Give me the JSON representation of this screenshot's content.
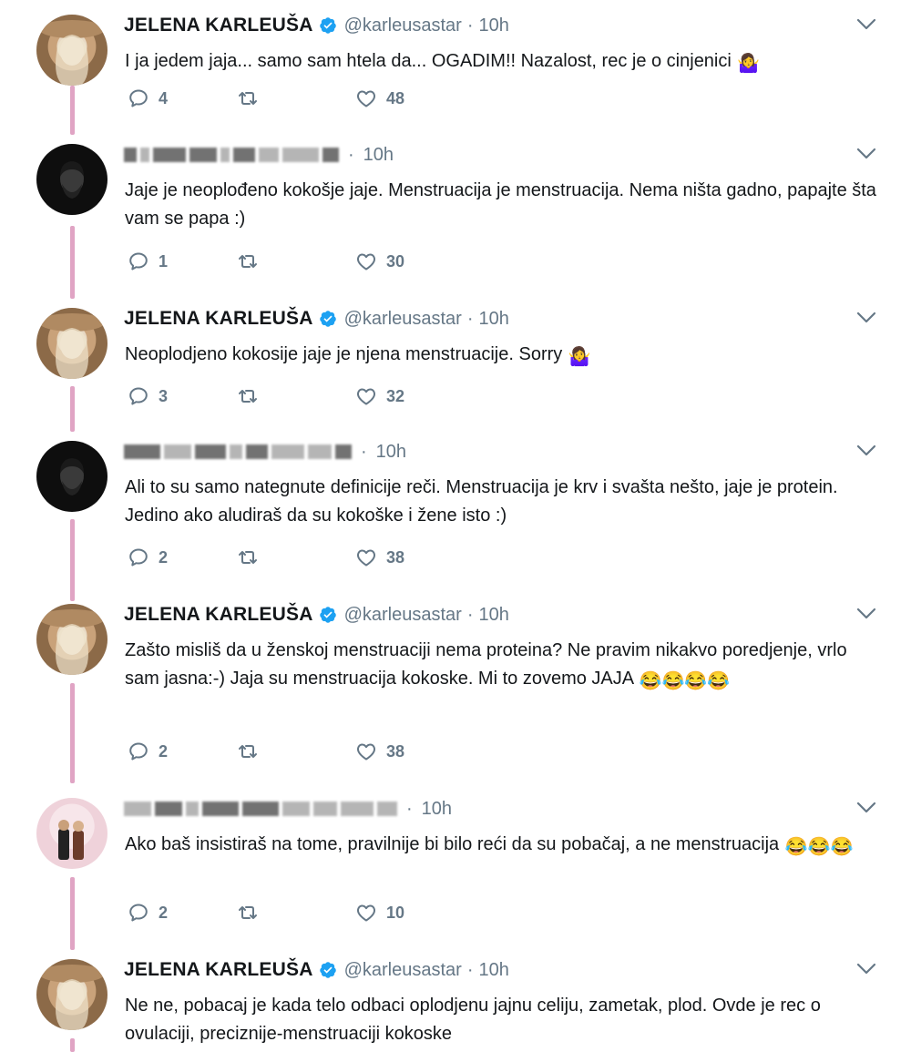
{
  "colors": {
    "thread_line": "#e0a4c4",
    "verified": "#1da1f2",
    "secondary_text": "#657786"
  },
  "tweets": [
    {
      "author_name": "JELENA KARLEUŠA",
      "verified": true,
      "handle": "@karleusastar",
      "separator": "·",
      "time": "10h",
      "text": "I ja jedem jaja... samo sam htela da... OGADIM!! Nazalost, rec je o cinjenici",
      "emoji": "🤷‍♀️",
      "replies": "4",
      "retweets": "",
      "likes": "48"
    },
    {
      "author_name": "",
      "verified": false,
      "handle": "",
      "separator": "·",
      "time": "10h",
      "text": "Jaje je neoplođeno kokošje jaje. Menstruacija je menstruacija. Nema ništa gadno, papajte šta vam se papa :)",
      "replies": "1",
      "retweets": "",
      "likes": "30"
    },
    {
      "author_name": "JELENA KARLEUŠA",
      "verified": true,
      "handle": "@karleusastar",
      "separator": "·",
      "time": "10h",
      "text": "Neoplodjeno kokosije jaje je njena menstruacije. Sorry",
      "emoji": "🤷‍♀️",
      "replies": "3",
      "retweets": "",
      "likes": "32"
    },
    {
      "author_name": "",
      "verified": false,
      "handle": "",
      "separator": "·",
      "time": "10h",
      "text": "Ali to su samo nategnute definicije reči. Menstruacija je krv i svašta nešto, jaje je protein. Jedino ako aludiraš da su kokoške i žene isto :)",
      "replies": "2",
      "retweets": "",
      "likes": "38"
    },
    {
      "author_name": "JELENA KARLEUŠA",
      "verified": true,
      "handle": "@karleusastar",
      "separator": "·",
      "time": "10h",
      "text": "Zašto misliš da u ženskoj menstruaciji nema proteina? Ne pravim nikakvo poredjenje, vrlo sam jasna:-) Jaja su menstruacija kokoske. Mi to zovemo JAJA",
      "emoji": "😂😂😂😂",
      "replies": "2",
      "retweets": "",
      "likes": "38"
    },
    {
      "author_name": "",
      "verified": false,
      "handle": "",
      "separator": "·",
      "time": "10h",
      "text": "Ako baš insistiraš na tome, pravilnije bi bilo reći da su pobačaj, a ne menstruacija",
      "emoji": "😂😂😂",
      "replies": "2",
      "retweets": "",
      "likes": "10"
    },
    {
      "author_name": "JELENA KARLEUŠA",
      "verified": true,
      "handle": "@karleusastar",
      "separator": "·",
      "time": "10h",
      "text": "Ne ne, pobacaj je kada telo odbaci oplodjenu jajnu celiju, zametak, plod. Ovde je rec o ovulaciji, preciznije-menstruaciji kokoske"
    }
  ]
}
